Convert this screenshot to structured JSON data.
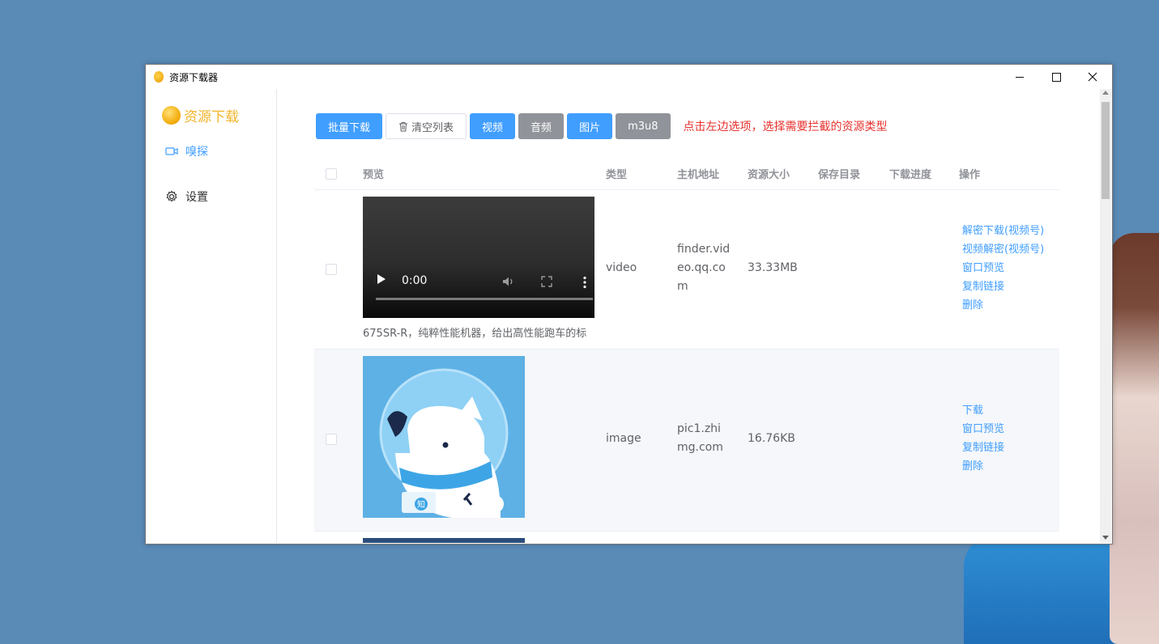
{
  "window": {
    "title": "资源下载器"
  },
  "sidebar": {
    "logo_text": "资源下载",
    "items": [
      {
        "label": "嗅探",
        "icon": "video-camera-icon",
        "active": true
      },
      {
        "label": "设置",
        "icon": "gear-icon",
        "active": false
      }
    ]
  },
  "toolbar": {
    "batch_download": "批量下载",
    "clear_list": "清空列表",
    "filters": [
      {
        "label": "视频",
        "active": true
      },
      {
        "label": "音频",
        "active": false
      },
      {
        "label": "图片",
        "active": true
      },
      {
        "label": "m3u8",
        "active": false
      }
    ],
    "hint": "点击左边选项，选择需要拦截的资源类型"
  },
  "table": {
    "columns": [
      "预览",
      "类型",
      "主机地址",
      "资源大小",
      "保存目录",
      "下载进度",
      "操作"
    ],
    "rows": [
      {
        "preview_caption": "675SR-R，纯粹性能机器，给出高性能跑车的标",
        "video_time": "0:00",
        "type": "video",
        "host_line1": "finder.vid",
        "host_line2": "eo.qq.co",
        "host_line3": "m",
        "size": "33.33MB",
        "save_dir": "",
        "progress": "",
        "actions": [
          "解密下载(视频号)",
          "视频解密(视频号)",
          "窗口预览",
          "复制链接",
          "删除"
        ]
      },
      {
        "type": "image",
        "host_line1": "pic1.zhi",
        "host_line2": "mg.com",
        "size": "16.76KB",
        "save_dir": "",
        "progress": "",
        "image_badge": "知",
        "actions": [
          "下载",
          "窗口预览",
          "复制链接",
          "删除"
        ]
      }
    ]
  },
  "colors": {
    "primary": "#409eff",
    "gray_button": "#909399",
    "hint_red": "#e6322e",
    "logo_gold": "#f0b429",
    "desktop": "#5a8ab6"
  }
}
